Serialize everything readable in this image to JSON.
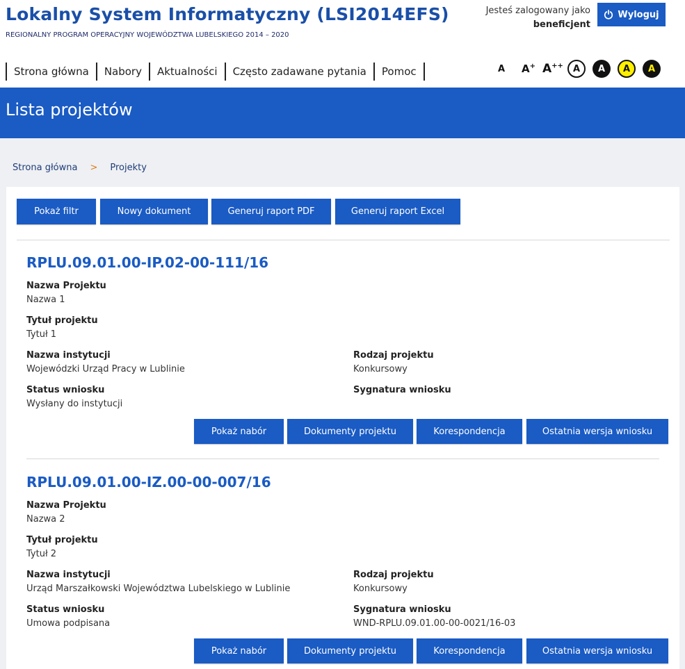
{
  "header": {
    "title": "Lokalny System Informatyczny (LSI2014EFS)",
    "subtitle": "REGIONALNY PROGRAM OPERACYJNY WOJEWÓDZTWA LUBELSKIEGO 2014 – 2020",
    "login_prefix": "Jesteś zalogowany jako",
    "login_role": "beneficjent",
    "logout_label": "Wyloguj"
  },
  "nav": [
    "Strona główna",
    "Nabory",
    "Aktualności",
    "Często zadawane pytania",
    "Pomoc"
  ],
  "a11y": {
    "font_small": "A",
    "font_medium": "A",
    "font_medium_sup": "+",
    "font_large": "A",
    "font_large_sup": "++",
    "contrast": [
      "A",
      "A",
      "A",
      "A"
    ]
  },
  "banner_title": "Lista projektów",
  "breadcrumb": {
    "home": "Strona główna",
    "separator": ">",
    "current": "Projekty"
  },
  "toolbar": {
    "filter": "Pokaż filtr",
    "new_doc": "Nowy dokument",
    "pdf": "Generuj raport PDF",
    "excel": "Generuj raport Excel"
  },
  "field_labels": {
    "name": "Nazwa Projektu",
    "title": "Tytuł projektu",
    "institution": "Nazwa instytucji",
    "type": "Rodzaj projektu",
    "status": "Status wniosku",
    "signature": "Sygnatura wniosku"
  },
  "project_actions": {
    "show_call": "Pokaż nabór",
    "documents": "Dokumenty projektu",
    "correspondence": "Korespondencja",
    "last_version": "Ostatnia wersja wniosku"
  },
  "projects": [
    {
      "number": "RPLU.09.01.00-IP.02-00-111/16",
      "name": "Nazwa 1",
      "title": "Tytuł 1",
      "institution": "Wojewódzki Urząd Pracy w Lublinie",
      "type": "Konkursowy",
      "status": "Wysłany do instytucji",
      "signature": ""
    },
    {
      "number": "RPLU.09.01.00-IZ.00-00-007/16",
      "name": "Nazwa 2",
      "title": "Tytuł 2",
      "institution": "Urząd Marszałkowski Województwa Lubelskiego w Lublinie",
      "type": "Konkursowy",
      "status": "Umowa podpisana",
      "signature": "WND-RPLU.09.01.00-00-0021/16-03"
    }
  ]
}
